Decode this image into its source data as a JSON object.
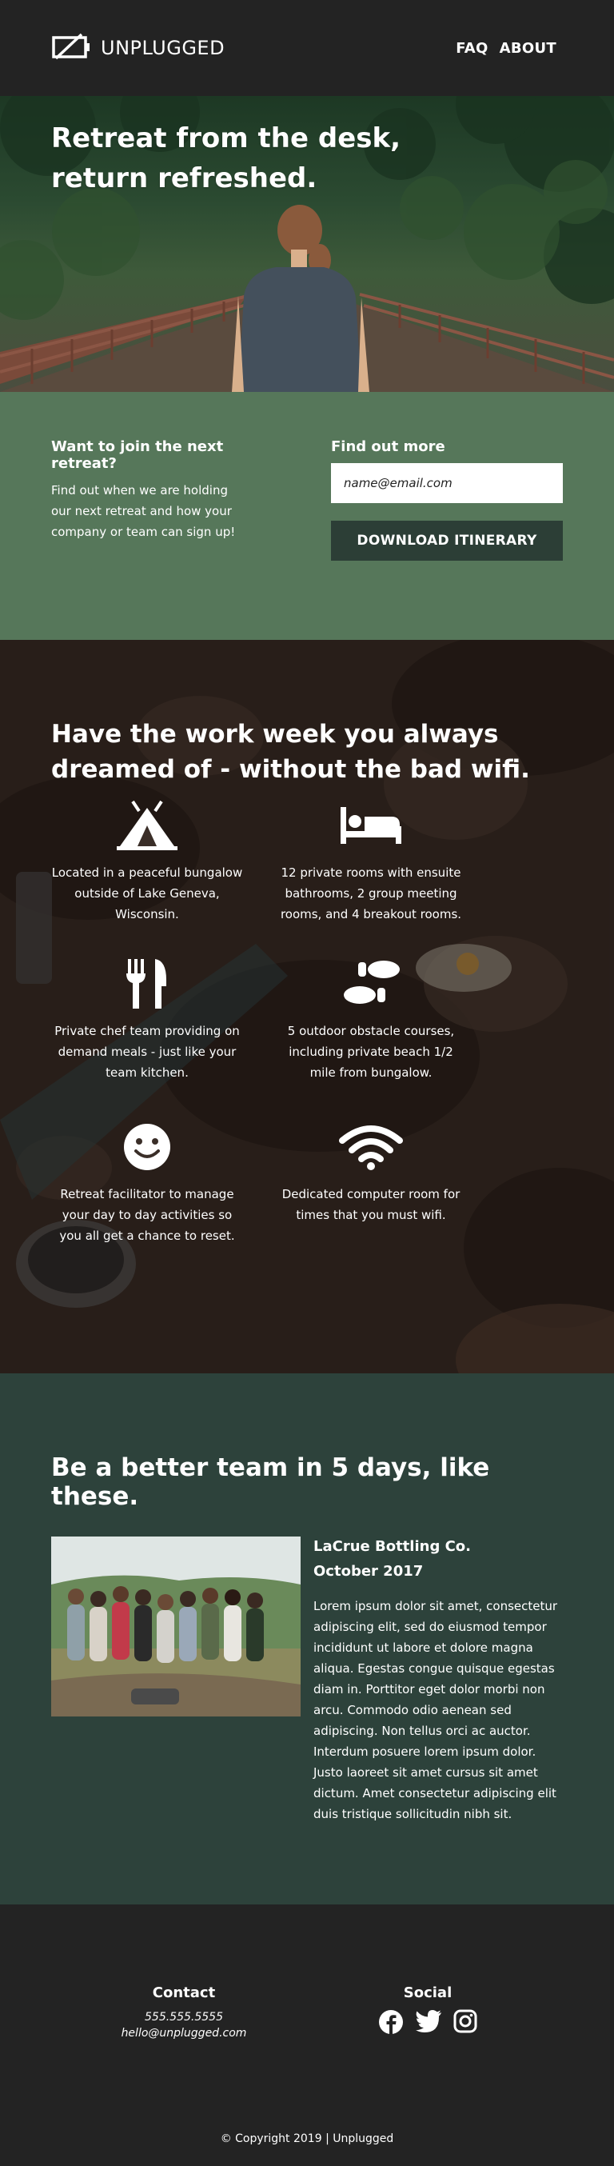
{
  "header": {
    "brand": "UNPLUGGED",
    "nav": [
      "FAQ",
      "ABOUT"
    ]
  },
  "hero": {
    "title": "Retreat from the desk, return refreshed."
  },
  "signup": {
    "heading": "Want to join the next retreat?",
    "text": "Find out when we are holding our next retreat and how your company or team can sign up!",
    "find_more": "Find out more",
    "email_placeholder": "name@email.com",
    "download_label": "DOWNLOAD ITINERARY"
  },
  "features": {
    "title": "Have the work week you always dreamed of - without the bad wifi.",
    "items": [
      {
        "icon": "tent-icon",
        "text": "Located in a peaceful bungalow outside of Lake Geneva, Wisconsin."
      },
      {
        "icon": "bed-icon",
        "text": "12 private rooms with ensuite bathrooms, 2 group meeting rooms, and 4 breakout rooms."
      },
      {
        "icon": "utensils-icon",
        "text": "Private chef team providing on demand meals - just like your team kitchen."
      },
      {
        "icon": "shoe-prints-icon",
        "text": "5 outdoor obstacle courses, including private beach 1/2 mile from bungalow."
      },
      {
        "icon": "smile-icon",
        "text": "Retreat facilitator to manage your day to day activities so you all get a chance to reset."
      },
      {
        "icon": "wifi-icon",
        "text": "Dedicated computer room for times that you must wifi."
      }
    ]
  },
  "team": {
    "title": "Be a better team in 5 days, like these.",
    "company": "LaCrue Bottling Co.",
    "date": "October 2017",
    "text": "Lorem ipsum dolor sit amet, consectetur adipiscing elit, sed do eiusmod tempor incididunt ut labore et dolore magna aliqua. Egestas congue quisque egestas diam in. Porttitor eget dolor morbi non arcu. Commodo odio aenean sed adipiscing. Non tellus orci ac auctor. Interdum posuere lorem ipsum dolor. Justo laoreet sit amet cursus sit amet dictum. Amet consectetur adipiscing elit duis tristique sollicitudin nibh sit."
  },
  "footer": {
    "contact_heading": "Contact",
    "phone": "555.555.5555",
    "email": "hello@unplugged.com",
    "social_heading": "Social",
    "socials": [
      "facebook-icon",
      "twitter-icon",
      "instagram-icon"
    ],
    "copyright": "© Copyright 2019 | Unplugged"
  },
  "colors": {
    "header_bg": "#232323",
    "signup_bg": "#56775a",
    "button_bg": "#2c3e36",
    "team_bg": "#2d423b"
  }
}
